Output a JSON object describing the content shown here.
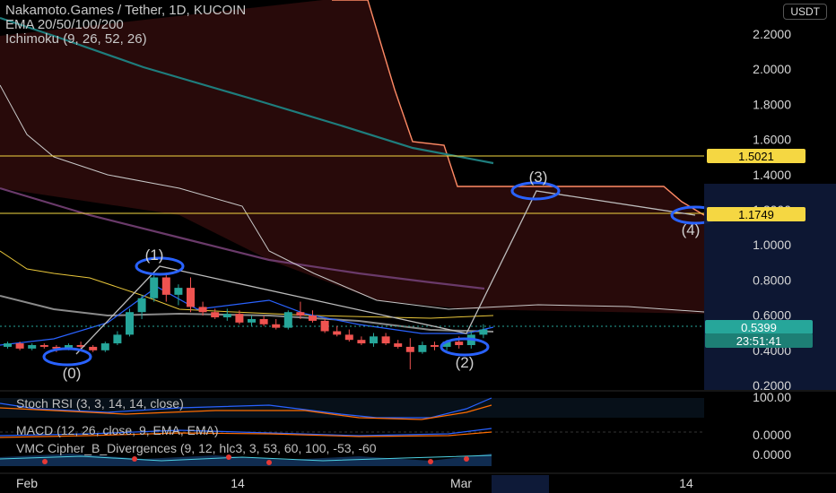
{
  "header": {
    "title": "Nakamoto.Games / Tether, 1D, KUCOIN",
    "ema": "EMA 20/50/100/200",
    "ichimoku": "Ichimoku (9, 26, 52, 26)",
    "currency": "USDT"
  },
  "price_axis": [
    "2.2000",
    "2.0000",
    "1.8000",
    "1.6000",
    "1.4000",
    "1.2000",
    "1.0000",
    "0.8000",
    "0.6000",
    "0.4000",
    "0.2000"
  ],
  "markers": {
    "level_a": "1.5021",
    "level_b": "1.1749",
    "last_price": "0.5399",
    "countdown": "23:51:41"
  },
  "wave_labels": [
    "(0)",
    "(1)",
    "(2)",
    "(3)",
    "(4)"
  ],
  "panes": {
    "stoch": {
      "label": "Stoch RSI (3, 3, 14, 14, close)",
      "axis": "100.00"
    },
    "macd": {
      "label": "MACD (12, 26, close, 9, EMA, EMA)",
      "axis": "0.0000"
    },
    "vmc": {
      "label": "VMC Cipher_B_Divergences (9, 12, hlc3, 3, 53, 60, 100, -53, -60",
      "axis": "0.0000"
    }
  },
  "time_axis": [
    "Feb",
    "14",
    "Mar",
    "14"
  ],
  "colors": {
    "up": "#26a69a",
    "down": "#ef5350",
    "cloud": "#3a0e0e",
    "level": "#f5d742",
    "marker": "#2962ff"
  },
  "chart_data": {
    "type": "candlestick",
    "title": "Nakamoto.Games / Tether, 1D, KUCOIN",
    "ylim": [
      0.1,
      2.35
    ],
    "candles": [
      [
        0.44,
        0.47,
        0.43,
        0.46
      ],
      [
        0.46,
        0.47,
        0.42,
        0.43
      ],
      [
        0.43,
        0.46,
        0.42,
        0.45
      ],
      [
        0.45,
        0.46,
        0.43,
        0.44
      ],
      [
        0.44,
        0.45,
        0.41,
        0.43
      ],
      [
        0.43,
        0.46,
        0.42,
        0.45
      ],
      [
        0.45,
        0.47,
        0.43,
        0.44
      ],
      [
        0.44,
        0.45,
        0.41,
        0.42
      ],
      [
        0.42,
        0.47,
        0.41,
        0.46
      ],
      [
        0.46,
        0.53,
        0.45,
        0.51
      ],
      [
        0.51,
        0.66,
        0.5,
        0.64
      ],
      [
        0.64,
        0.74,
        0.6,
        0.72
      ],
      [
        0.72,
        0.86,
        0.7,
        0.84
      ],
      [
        0.84,
        0.86,
        0.7,
        0.74
      ],
      [
        0.74,
        0.8,
        0.68,
        0.78
      ],
      [
        0.78,
        0.84,
        0.64,
        0.67
      ],
      [
        0.67,
        0.7,
        0.62,
        0.64
      ],
      [
        0.64,
        0.66,
        0.6,
        0.61
      ],
      [
        0.61,
        0.66,
        0.59,
        0.63
      ],
      [
        0.63,
        0.65,
        0.57,
        0.58
      ],
      [
        0.58,
        0.62,
        0.56,
        0.6
      ],
      [
        0.6,
        0.62,
        0.56,
        0.57
      ],
      [
        0.57,
        0.6,
        0.54,
        0.55
      ],
      [
        0.55,
        0.65,
        0.54,
        0.64
      ],
      [
        0.64,
        0.7,
        0.6,
        0.62
      ],
      [
        0.62,
        0.65,
        0.58,
        0.59
      ],
      [
        0.59,
        0.6,
        0.52,
        0.53
      ],
      [
        0.53,
        0.56,
        0.5,
        0.51
      ],
      [
        0.51,
        0.54,
        0.47,
        0.48
      ],
      [
        0.48,
        0.5,
        0.45,
        0.46
      ],
      [
        0.46,
        0.52,
        0.44,
        0.5
      ],
      [
        0.5,
        0.52,
        0.45,
        0.46
      ],
      [
        0.46,
        0.48,
        0.43,
        0.44
      ],
      [
        0.44,
        0.49,
        0.31,
        0.41
      ],
      [
        0.41,
        0.47,
        0.4,
        0.45
      ],
      [
        0.45,
        0.47,
        0.42,
        0.44
      ],
      [
        0.44,
        0.48,
        0.42,
        0.47
      ],
      [
        0.47,
        0.5,
        0.43,
        0.45
      ],
      [
        0.45,
        0.53,
        0.43,
        0.51
      ],
      [
        0.51,
        0.57,
        0.49,
        0.54
      ]
    ]
  }
}
